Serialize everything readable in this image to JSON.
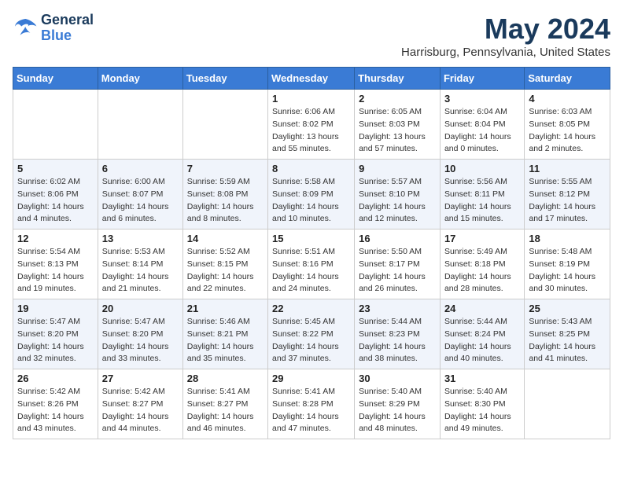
{
  "header": {
    "logo_line1": "General",
    "logo_line2": "Blue",
    "month_title": "May 2024",
    "location": "Harrisburg, Pennsylvania, United States"
  },
  "days_of_week": [
    "Sunday",
    "Monday",
    "Tuesday",
    "Wednesday",
    "Thursday",
    "Friday",
    "Saturday"
  ],
  "weeks": [
    [
      {
        "day": "",
        "info": ""
      },
      {
        "day": "",
        "info": ""
      },
      {
        "day": "",
        "info": ""
      },
      {
        "day": "1",
        "info": "Sunrise: 6:06 AM\nSunset: 8:02 PM\nDaylight: 13 hours\nand 55 minutes."
      },
      {
        "day": "2",
        "info": "Sunrise: 6:05 AM\nSunset: 8:03 PM\nDaylight: 13 hours\nand 57 minutes."
      },
      {
        "day": "3",
        "info": "Sunrise: 6:04 AM\nSunset: 8:04 PM\nDaylight: 14 hours\nand 0 minutes."
      },
      {
        "day": "4",
        "info": "Sunrise: 6:03 AM\nSunset: 8:05 PM\nDaylight: 14 hours\nand 2 minutes."
      }
    ],
    [
      {
        "day": "5",
        "info": "Sunrise: 6:02 AM\nSunset: 8:06 PM\nDaylight: 14 hours\nand 4 minutes."
      },
      {
        "day": "6",
        "info": "Sunrise: 6:00 AM\nSunset: 8:07 PM\nDaylight: 14 hours\nand 6 minutes."
      },
      {
        "day": "7",
        "info": "Sunrise: 5:59 AM\nSunset: 8:08 PM\nDaylight: 14 hours\nand 8 minutes."
      },
      {
        "day": "8",
        "info": "Sunrise: 5:58 AM\nSunset: 8:09 PM\nDaylight: 14 hours\nand 10 minutes."
      },
      {
        "day": "9",
        "info": "Sunrise: 5:57 AM\nSunset: 8:10 PM\nDaylight: 14 hours\nand 12 minutes."
      },
      {
        "day": "10",
        "info": "Sunrise: 5:56 AM\nSunset: 8:11 PM\nDaylight: 14 hours\nand 15 minutes."
      },
      {
        "day": "11",
        "info": "Sunrise: 5:55 AM\nSunset: 8:12 PM\nDaylight: 14 hours\nand 17 minutes."
      }
    ],
    [
      {
        "day": "12",
        "info": "Sunrise: 5:54 AM\nSunset: 8:13 PM\nDaylight: 14 hours\nand 19 minutes."
      },
      {
        "day": "13",
        "info": "Sunrise: 5:53 AM\nSunset: 8:14 PM\nDaylight: 14 hours\nand 21 minutes."
      },
      {
        "day": "14",
        "info": "Sunrise: 5:52 AM\nSunset: 8:15 PM\nDaylight: 14 hours\nand 22 minutes."
      },
      {
        "day": "15",
        "info": "Sunrise: 5:51 AM\nSunset: 8:16 PM\nDaylight: 14 hours\nand 24 minutes."
      },
      {
        "day": "16",
        "info": "Sunrise: 5:50 AM\nSunset: 8:17 PM\nDaylight: 14 hours\nand 26 minutes."
      },
      {
        "day": "17",
        "info": "Sunrise: 5:49 AM\nSunset: 8:18 PM\nDaylight: 14 hours\nand 28 minutes."
      },
      {
        "day": "18",
        "info": "Sunrise: 5:48 AM\nSunset: 8:19 PM\nDaylight: 14 hours\nand 30 minutes."
      }
    ],
    [
      {
        "day": "19",
        "info": "Sunrise: 5:47 AM\nSunset: 8:20 PM\nDaylight: 14 hours\nand 32 minutes."
      },
      {
        "day": "20",
        "info": "Sunrise: 5:47 AM\nSunset: 8:20 PM\nDaylight: 14 hours\nand 33 minutes."
      },
      {
        "day": "21",
        "info": "Sunrise: 5:46 AM\nSunset: 8:21 PM\nDaylight: 14 hours\nand 35 minutes."
      },
      {
        "day": "22",
        "info": "Sunrise: 5:45 AM\nSunset: 8:22 PM\nDaylight: 14 hours\nand 37 minutes."
      },
      {
        "day": "23",
        "info": "Sunrise: 5:44 AM\nSunset: 8:23 PM\nDaylight: 14 hours\nand 38 minutes."
      },
      {
        "day": "24",
        "info": "Sunrise: 5:44 AM\nSunset: 8:24 PM\nDaylight: 14 hours\nand 40 minutes."
      },
      {
        "day": "25",
        "info": "Sunrise: 5:43 AM\nSunset: 8:25 PM\nDaylight: 14 hours\nand 41 minutes."
      }
    ],
    [
      {
        "day": "26",
        "info": "Sunrise: 5:42 AM\nSunset: 8:26 PM\nDaylight: 14 hours\nand 43 minutes."
      },
      {
        "day": "27",
        "info": "Sunrise: 5:42 AM\nSunset: 8:27 PM\nDaylight: 14 hours\nand 44 minutes."
      },
      {
        "day": "28",
        "info": "Sunrise: 5:41 AM\nSunset: 8:27 PM\nDaylight: 14 hours\nand 46 minutes."
      },
      {
        "day": "29",
        "info": "Sunrise: 5:41 AM\nSunset: 8:28 PM\nDaylight: 14 hours\nand 47 minutes."
      },
      {
        "day": "30",
        "info": "Sunrise: 5:40 AM\nSunset: 8:29 PM\nDaylight: 14 hours\nand 48 minutes."
      },
      {
        "day": "31",
        "info": "Sunrise: 5:40 AM\nSunset: 8:30 PM\nDaylight: 14 hours\nand 49 minutes."
      },
      {
        "day": "",
        "info": ""
      }
    ]
  ]
}
